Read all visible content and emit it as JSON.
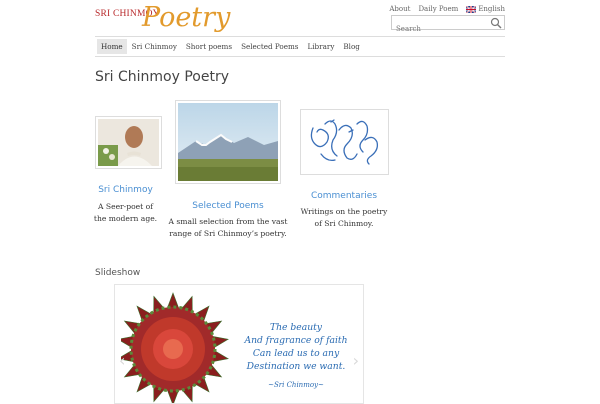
{
  "brand": {
    "small": "SRI CHINMOY",
    "big": "Poetry"
  },
  "toplinks": {
    "about": "About",
    "daily": "Daily Poem",
    "language": "English"
  },
  "search": {
    "placeholder": "Search"
  },
  "nav": {
    "items": [
      "Home",
      "Sri Chinmoy",
      "Short poems",
      "Selected Poems",
      "Library",
      "Blog"
    ],
    "active_index": 0
  },
  "page": {
    "title": "Sri Chinmoy Poetry"
  },
  "cards": [
    {
      "link": "Sri Chinmoy",
      "desc": [
        "A Seer-poet of",
        "the modern age."
      ]
    },
    {
      "link": "Selected Poems",
      "desc": [
        "A small selection from the vast",
        "range of Sri Chinmoy’s poetry."
      ]
    },
    {
      "link": "Commentaries",
      "desc": [
        "Writings on the poetry",
        "of Sri Chinmoy."
      ]
    }
  ],
  "slideshow": {
    "title": "Slideshow",
    "quote_lines": [
      "The beauty",
      "And fragrance of faith",
      "Can lead us to any",
      "Destination we want."
    ],
    "signature": "~Sri Chinmoy~"
  },
  "colors": {
    "link": "#4a8fd2",
    "logo_red": "#b8292b",
    "logo_orange": "#e29a2c",
    "quote_blue": "#2a6bb2"
  }
}
